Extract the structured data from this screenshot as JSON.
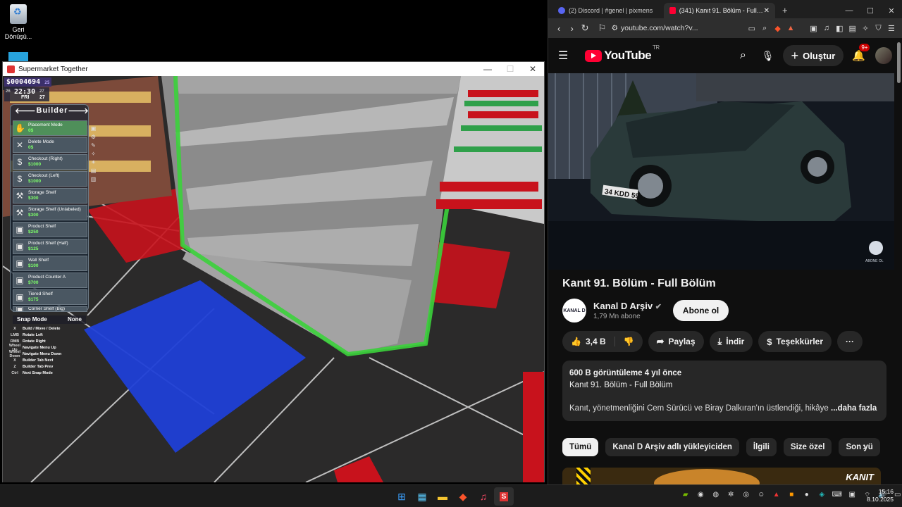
{
  "desktop": {
    "recycle_bin_label": "Geri\nDönüşü..."
  },
  "game_window": {
    "title": "Supermarket Together",
    "money": "$0004694",
    "money_suffix": "25",
    "clock_time": "22:30",
    "clock_day": "FRI",
    "clock_left_small": "26",
    "clock_right_small": "27",
    "clock_right_small2": "27",
    "builder": {
      "title": "Builder",
      "items": [
        {
          "name": "Placement Mode",
          "price": "0$",
          "icon": "hand-icon"
        },
        {
          "name": "Delete Mode",
          "price": "0$",
          "icon": "x-icon"
        },
        {
          "name": "Checkout (Right)",
          "price": "$1000",
          "icon": "dollar-icon"
        },
        {
          "name": "Checkout (Left)",
          "price": "$1000",
          "icon": "dollar-icon"
        },
        {
          "name": "Storage Shelf",
          "price": "$300",
          "icon": "wrench-icon"
        },
        {
          "name": "Storage Shelf (Unlabeled)",
          "price": "$300",
          "icon": "wrench-icon"
        },
        {
          "name": "Product Shelf",
          "price": "$250",
          "icon": "box-icon"
        },
        {
          "name": "Product Shelf (Half)",
          "price": "$125",
          "icon": "box-icon"
        },
        {
          "name": "Wall Shelf",
          "price": "$100",
          "icon": "box-icon"
        },
        {
          "name": "Product Counter A",
          "price": "$700",
          "icon": "box-icon"
        },
        {
          "name": "Tiered Shelf",
          "price": "$175",
          "icon": "box-icon"
        },
        {
          "name": "Corner Shelf (Big)",
          "price": "",
          "icon": "box-icon"
        }
      ]
    },
    "snap_mode_label": "Snap Mode",
    "snap_mode_value": "None",
    "keybinds": [
      {
        "key": "X",
        "action": "Build / Move / Delete"
      },
      {
        "key": "LMB",
        "action": "Rotate Left"
      },
      {
        "key": "RMB",
        "action": "Rotate Right"
      },
      {
        "key": "Wheel Up",
        "action": "Navigate Menu Up"
      },
      {
        "key": "Wheel Down",
        "action": "Navigate Menu Down"
      },
      {
        "key": "X",
        "action": "Builder Tab Next"
      },
      {
        "key": "Z",
        "action": "Builder Tab Prev"
      },
      {
        "key": "Ctrl",
        "action": "Next Snap Mode"
      }
    ]
  },
  "browser": {
    "tabs": [
      {
        "title": "(2) Discord | #genel | pixmens",
        "active": false,
        "favicon_color": "#5865f2"
      },
      {
        "title": "(341) Kanıt 91. Bölüm - Full Bölüm",
        "active": true,
        "favicon_color": "#ff0033"
      }
    ],
    "url": "youtube.com/watch?v...",
    "youtube": {
      "logo_text": "YouTube",
      "region": "TR",
      "create_label": "Oluştur",
      "notifications_badge": "9+",
      "video_plate": "34 KDD 59",
      "video_watermark": "ABONE OL",
      "video_title": "Kanıt 91. Bölüm - Full Bölüm",
      "channel_name": "Kanal D Arşiv",
      "channel_subs": "1,79 Mn abone",
      "channel_logo_text": "KANAL D",
      "subscribe_label": "Abone ol",
      "likes": "3,4 B",
      "share_label": "Paylaş",
      "download_label": "İndir",
      "thanks_label": "Teşekkürler",
      "more_label": "···",
      "desc_views": "600 B görüntüleme  4 yıl önce",
      "desc_line1": "Kanıt 91. Bölüm - Full Bölüm",
      "desc_line2": "Kanıt, yönetmenliğini Cem Sürücü ve Biray Dalkıran'ın üstlendiği, hikâye",
      "desc_more": "...daha fazla",
      "chips": [
        "Tümü",
        "Kanal D Arşiv adlı yükleyiciden",
        "İlgili",
        "Size özel",
        "Son yü"
      ],
      "next_thumb_text": "KANIT"
    }
  },
  "taskbar": {
    "apps": [
      "windows-icon",
      "widgets-icon",
      "explorer-icon",
      "brave-icon",
      "music-icon",
      "supermarket-icon"
    ],
    "time": "15:16",
    "date": "8.10.2025"
  },
  "colors": {
    "accent_green": "#3bd13b",
    "floor_red": "#c8121c",
    "floor_blue": "#1f3fd6",
    "yt_red": "#ff0033"
  }
}
